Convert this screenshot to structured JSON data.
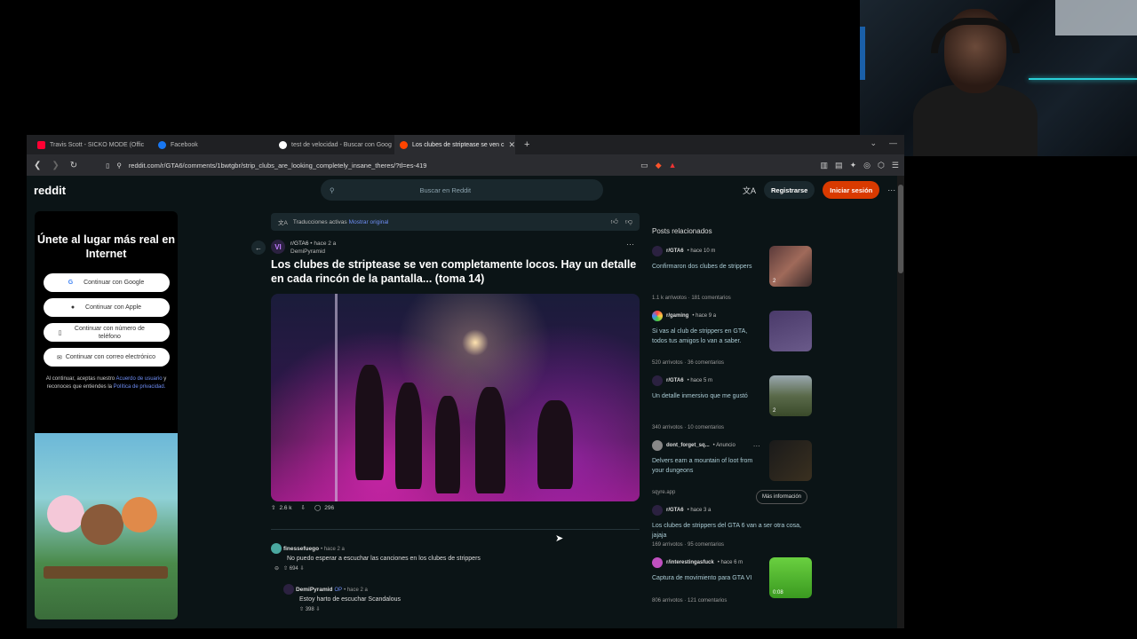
{
  "browser": {
    "tabs": [
      {
        "label": "Travis Scott - SICKO MODE (Offic",
        "icon_color": "#ff0033"
      },
      {
        "label": "Facebook",
        "icon_color": "#1877f2"
      },
      {
        "label": "test de velocidad - Buscar con Goog",
        "icon_color": "#4285f4"
      },
      {
        "label": "Los clubes de striptease se ven c",
        "icon_color": "#ff4500"
      }
    ],
    "new_tab": "+",
    "url": "reddit.com/r/GTA6/comments/1bwtgbr/strip_clubs_are_looking_completely_insane_theres/?tl=es-419"
  },
  "header": {
    "logo": "reddit",
    "search_placeholder": "Buscar en Reddit",
    "register_label": "Registrarse",
    "login_label": "Iniciar sesión",
    "more": "···"
  },
  "signup": {
    "title": "Únete al lugar más real en Internet",
    "google": "Continuar con Google",
    "apple": "Continuar con Apple",
    "phone": "Continuar con número de teléfono",
    "email": "Continuar con correo electrónico",
    "legal_a": "Al continuar, aceptas nuestro",
    "legal_link1": "Acuerdo de usuario",
    "legal_b": "y reconoces que entiendes la",
    "legal_link2": "Política de privacidad."
  },
  "post": {
    "translation_text": "Traducciones activas",
    "translation_link": "Mostrar original",
    "subreddit": "r/GTA6",
    "time": "• hace 2 a",
    "author": "DemiPyramid",
    "title": "Los clubes de striptease se ven completamente locos. Hay un detalle en cada rincón de la pantalla... (toma 14)",
    "votes": "2.6 k",
    "comments": "296",
    "more": "···"
  },
  "comments": [
    {
      "user": "finessefuego",
      "time": "• hace 2 a",
      "text": "No puedo esperar a escuchar las canciones en los clubes de strippers",
      "votes": "694"
    },
    {
      "user": "DemiPyramid",
      "op": "OP",
      "time": "• hace 2 a",
      "text": "Estoy harto de escuchar Scandalous",
      "votes": "398"
    }
  ],
  "related": {
    "heading": "Posts relacionados",
    "items": [
      {
        "sub": "r/GTA6",
        "time": "• hace 10 m",
        "title": "Confirmaron dos clubes de strippers",
        "stats": "1.1 k arriwotos  ·  181 comentarios",
        "badge": "2"
      },
      {
        "sub": "r/gaming",
        "time": "• hace 9 a",
        "title": "Si vas al club de strippers en GTA, todos tus amigos lo van a saber.",
        "stats": "520 arrivotos  ·  36 comentarios"
      },
      {
        "sub": "r/GTA6",
        "time": "• hace 5 m",
        "title": "Un detalle inmersivo que me gustó",
        "stats": "340 arrivotos  ·  10 comentarios",
        "badge": "2"
      },
      {
        "sub": "dont_forget_sq...",
        "time": "• Anuncio",
        "title": "Delvers earn a mountain of loot from your dungeons",
        "stats": "sqyre.app",
        "button": "Más información"
      },
      {
        "sub": "r/GTA6",
        "time": "• hace 3 a",
        "title": "Los clubes de strippers del GTA 6 van a ser otra cosa, jajaja",
        "stats": "169 arrivotos  ·  95 comentarios"
      },
      {
        "sub": "r/interestingasfuck",
        "time": "• hace 6 m",
        "title": "Captura de movimiento para GTA VI",
        "stats": "806 arrivotos  ·  121 comentarios",
        "badge": "0:08"
      }
    ]
  }
}
